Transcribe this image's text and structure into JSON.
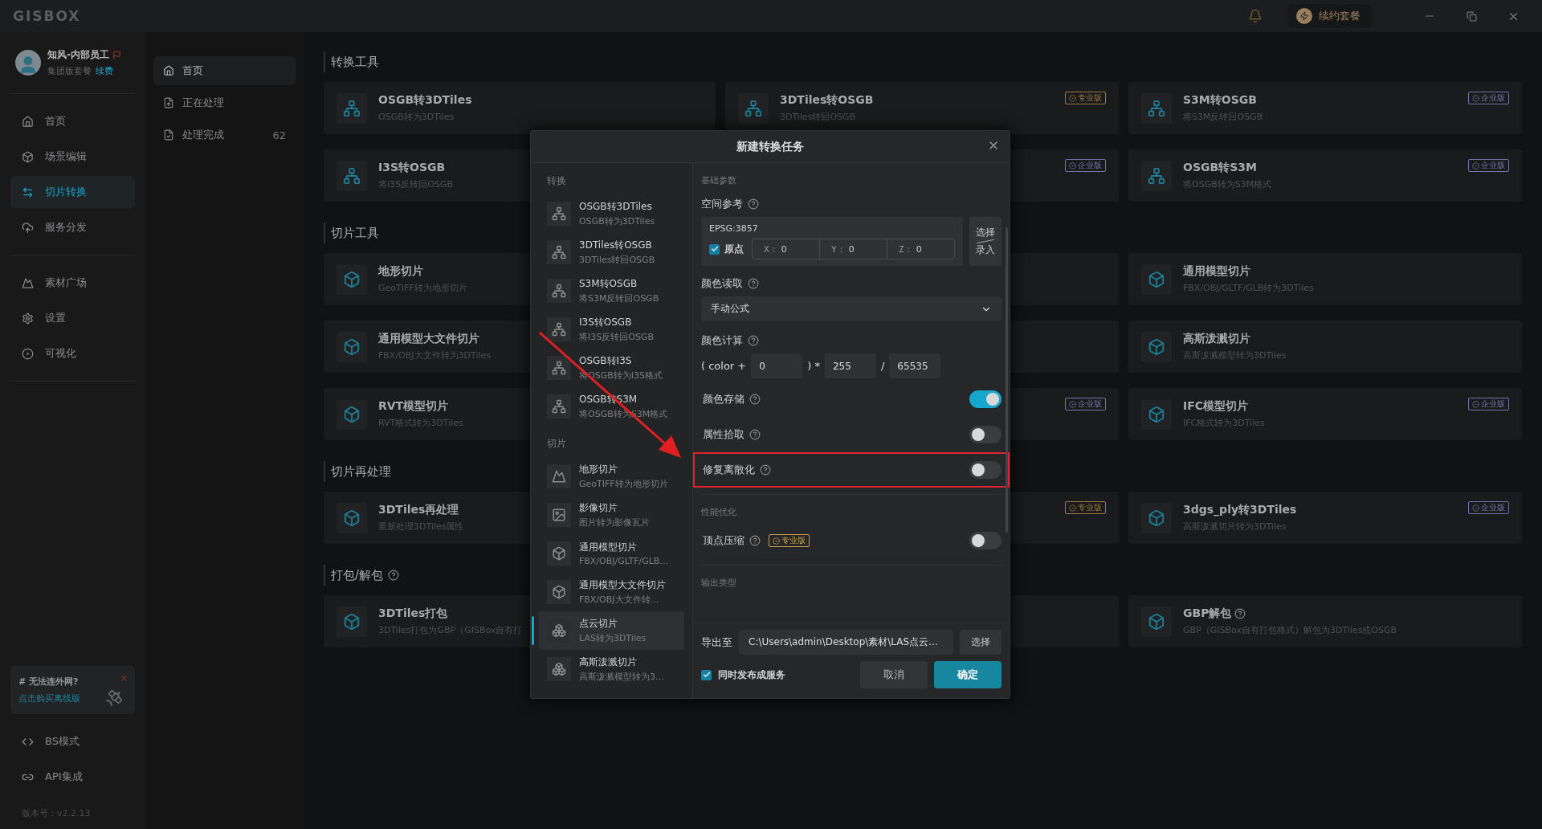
{
  "topbar": {
    "logo": "GISBOX",
    "renew": "续约套餐"
  },
  "user": {
    "name": "知风-内部员工",
    "plan": "集团版套餐",
    "renew_link": "续费"
  },
  "nav_groups": [
    [
      {
        "label": "首页",
        "selected": false
      },
      {
        "label": "场景编辑",
        "selected": false
      },
      {
        "label": "切片转换",
        "selected": true
      },
      {
        "label": "服务分发",
        "selected": false
      }
    ],
    [
      {
        "label": "素材广场",
        "selected": false
      },
      {
        "label": "设置",
        "selected": false
      },
      {
        "label": "可视化",
        "selected": false
      }
    ]
  ],
  "promo": {
    "title": "# 无法连外网?",
    "link": "点击购买离线版"
  },
  "bottom_nav": [
    {
      "label": "BS模式"
    },
    {
      "label": "API集成"
    }
  ],
  "version": "版本号：v2.2.13",
  "subnav": [
    {
      "label": "首页",
      "selected": true
    },
    {
      "label": "正在处理",
      "selected": false
    },
    {
      "label": "处理完成",
      "selected": false,
      "count": "62"
    }
  ],
  "sections": [
    {
      "title": "转换工具",
      "rows": [
        [
          {
            "title": "OSGB转3DTiles",
            "subtitle": "OSGB转为3DTiles"
          },
          {
            "title": "3DTiles转OSGB",
            "subtitle": "3DTiles转回OSGB",
            "badge": {
              "text": "专业版",
              "color": "#9a7b3d"
            }
          },
          {
            "title": "S3M转OSGB",
            "subtitle": "将S3M反转回OSGB",
            "badge": {
              "text": "企业版",
              "color": "#7a70a8"
            }
          }
        ],
        [
          {
            "title": "I3S转OSGB",
            "subtitle": "将I3S反转回OSGB"
          },
          {
            "badge": {
              "text": "企业版",
              "color": "#7a70a8"
            }
          },
          {
            "title": "OSGB转S3M",
            "subtitle": "将OSGB转为S3M格式",
            "badge": {
              "text": "企业版",
              "color": "#7a70a8"
            }
          }
        ]
      ]
    },
    {
      "title": "切片工具",
      "rows": [
        [
          {
            "title": "地形切片",
            "subtitle": "GeoTIFF转为地形切片"
          },
          null,
          {
            "title": "通用模型切片",
            "subtitle": "FBX/OBJ/GLTF/GLB转为3DTiles"
          }
        ],
        [
          {
            "title": "通用模型大文件切片",
            "subtitle": "FBX/OBJ大文件转为3DTiles"
          },
          null,
          {
            "title": "高斯泼溅切片",
            "subtitle": "高斯泼溅模型转为3DTiles"
          }
        ],
        [
          {
            "title": "RVT模型切片",
            "subtitle": "RVT格式转为3DTiles"
          },
          {
            "badge": {
              "text": "企业版",
              "color": "#7a70a8"
            }
          },
          {
            "title": "IFC模型切片",
            "subtitle": "IFC格式转为3DTiles",
            "badge": {
              "text": "企业版",
              "color": "#7a70a8"
            }
          }
        ]
      ]
    },
    {
      "title": "切片再处理",
      "rows": [
        [
          {
            "title": "3DTiles再处理",
            "subtitle": "重新处理3DTiles属性"
          },
          {
            "badge": {
              "text": "专业版",
              "color": "#9a7b3d"
            }
          },
          {
            "title": "3dgs_ply转3DTiles",
            "subtitle": "高斯泼溅切片转为3DTiles",
            "badge": {
              "text": "企业版",
              "color": "#7a70a8"
            }
          }
        ]
      ]
    },
    {
      "title": "打包/解包",
      "help": true,
      "rows": [
        [
          {
            "title": "3DTiles打包",
            "subtitle": "3DTiles打包为GBP（GISBox自有打"
          },
          null,
          {
            "title": "GBP解包",
            "help": true,
            "subtitle": "GBP（GISBox自有打包格式）解包为3DTiles或OSGB"
          }
        ]
      ]
    }
  ],
  "modal": {
    "title": "新建转换任务",
    "groups": [
      {
        "label": "转换",
        "items": [
          {
            "title": "OSGB转3DTiles",
            "subtitle": "OSGB转为3DTiles",
            "selected": false
          },
          {
            "title": "3DTiles转OSGB",
            "subtitle": "3DTiles转回OSGB",
            "selected": false
          },
          {
            "title": "S3M转OSGB",
            "subtitle": "将S3M反转回OSGB",
            "selected": false
          },
          {
            "title": "I3S转OSGB",
            "subtitle": "将I3S反转回OSGB",
            "selected": false
          },
          {
            "title": "OSGB转I3S",
            "subtitle": "将OSGB转为I3S格式",
            "selected": false
          },
          {
            "title": "OSGB转S3M",
            "subtitle": "将OSGB转为S3M格式",
            "selected": false
          }
        ]
      },
      {
        "label": "切片",
        "items": [
          {
            "title": "地形切片",
            "subtitle": "GeoTIFF转为地形切片",
            "selected": false
          },
          {
            "title": "影像切片",
            "subtitle": "图片转为影像瓦片",
            "selected": false
          },
          {
            "title": "通用模型切片",
            "subtitle": "FBX/OBJ/GLTF/GLB…",
            "selected": false
          },
          {
            "title": "通用模型大文件切片",
            "subtitle": "FBX/OBJ大文件转…",
            "selected": false
          },
          {
            "title": "点云切片",
            "subtitle": "LAS转为3DTiles",
            "selected": true
          },
          {
            "title": "高斯泼溅切片",
            "subtitle": "高斯泼溅模型转为3…",
            "selected": false
          }
        ]
      }
    ],
    "rows": [
      {
        "kind": "section",
        "label": "基础参数"
      },
      {
        "kind": "spatial",
        "label": "空间参考",
        "epsg": "EPSG:3857",
        "origin": {
          "label": "原点",
          "checked": true
        },
        "coords": [
          {
            "axis": "X：",
            "value": "0"
          },
          {
            "axis": "Y：",
            "value": "0"
          },
          {
            "axis": "Z：",
            "value": "0"
          }
        ],
        "button": [
          "选择",
          "录入"
        ]
      },
      {
        "kind": "select",
        "label": "颜色读取",
        "value": "手动公式"
      },
      {
        "kind": "formula",
        "label": "颜色计算",
        "parts": [
          {
            "kind": "text",
            "text": "( color +"
          },
          {
            "kind": "input",
            "text": "0"
          },
          {
            "kind": "text",
            "text": ") *"
          },
          {
            "kind": "input",
            "text": "255"
          },
          {
            "kind": "text",
            "text": "/"
          },
          {
            "kind": "input",
            "text": "65535"
          }
        ]
      },
      {
        "kind": "toggle",
        "label": "颜色存储",
        "on": true,
        "highlighted": false
      },
      {
        "kind": "toggle",
        "label": "属性拾取",
        "on": false,
        "highlighted": false
      },
      {
        "kind": "toggle",
        "label": "修复离散化",
        "on": false,
        "highlighted": true
      },
      {
        "kind": "section",
        "label": "性能优化",
        "divider": true
      },
      {
        "kind": "toggle",
        "label": "顶点压缩",
        "on": false,
        "highlighted": false,
        "badge": "专业版"
      },
      {
        "kind": "section",
        "label": "输出类型",
        "divider": true
      }
    ],
    "export": {
      "label": "导出至",
      "path": "C:\\Users\\admin\\Desktop\\素材\\LAS点云…",
      "button": "选择"
    },
    "publish": {
      "label": "同时发布成服务",
      "checked": true
    },
    "cancel": "取消",
    "confirm": "确定"
  }
}
